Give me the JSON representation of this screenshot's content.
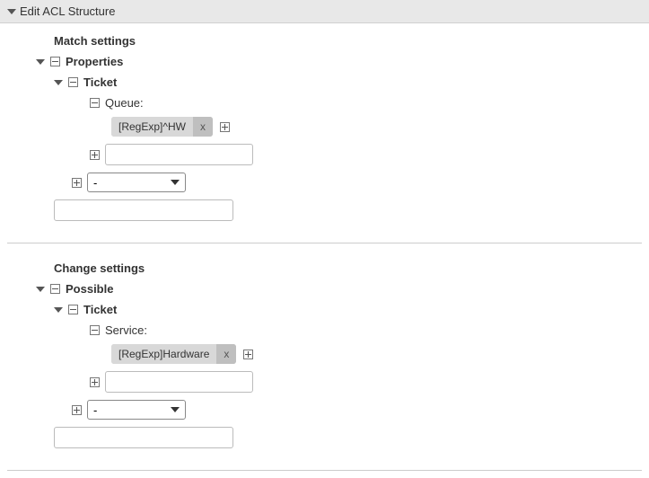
{
  "header": {
    "title": "Edit ACL Structure"
  },
  "match": {
    "title": "Match settings",
    "properties_label": "Properties",
    "ticket_label": "Ticket",
    "queue_label": "Queue:",
    "queue_tag": "[RegExp]^HW",
    "tag_close": "x",
    "add_input_value": "",
    "select_value": "-",
    "bottom_input_value": ""
  },
  "change": {
    "title": "Change settings",
    "possible_label": "Possible",
    "ticket_label": "Ticket",
    "service_label": "Service:",
    "service_tag": "[RegExp]Hardware",
    "tag_close": "x",
    "add_input_value": "",
    "select_value": "-",
    "bottom_input_value": ""
  }
}
